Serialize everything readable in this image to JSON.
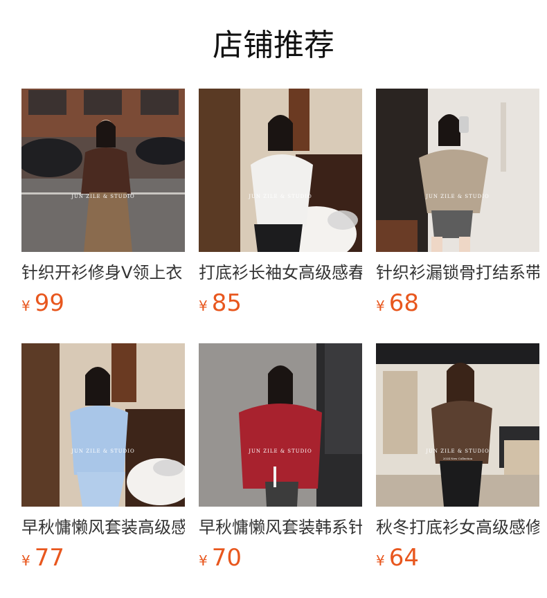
{
  "page": {
    "title": "店铺推荐"
  },
  "watermark": {
    "line1": "JUN ZILE & STUDIO",
    "line2": "2024 New Collection"
  },
  "currency_symbol": "¥",
  "colors": {
    "price": "#e8571e",
    "title": "#111111",
    "text": "#333333"
  },
  "products": [
    {
      "name": "针织开衫修身V领上衣",
      "price": "99"
    },
    {
      "name": "打底衫长袖女高级感春",
      "price": "85"
    },
    {
      "name": "针织衫漏锁骨打结系带",
      "price": "68"
    },
    {
      "name": "早秋慵懒风套装高级感",
      "price": "77"
    },
    {
      "name": "早秋慵懒风套装韩系针",
      "price": "70"
    },
    {
      "name": "秋冬打底衫女高级感修",
      "price": "64"
    }
  ]
}
